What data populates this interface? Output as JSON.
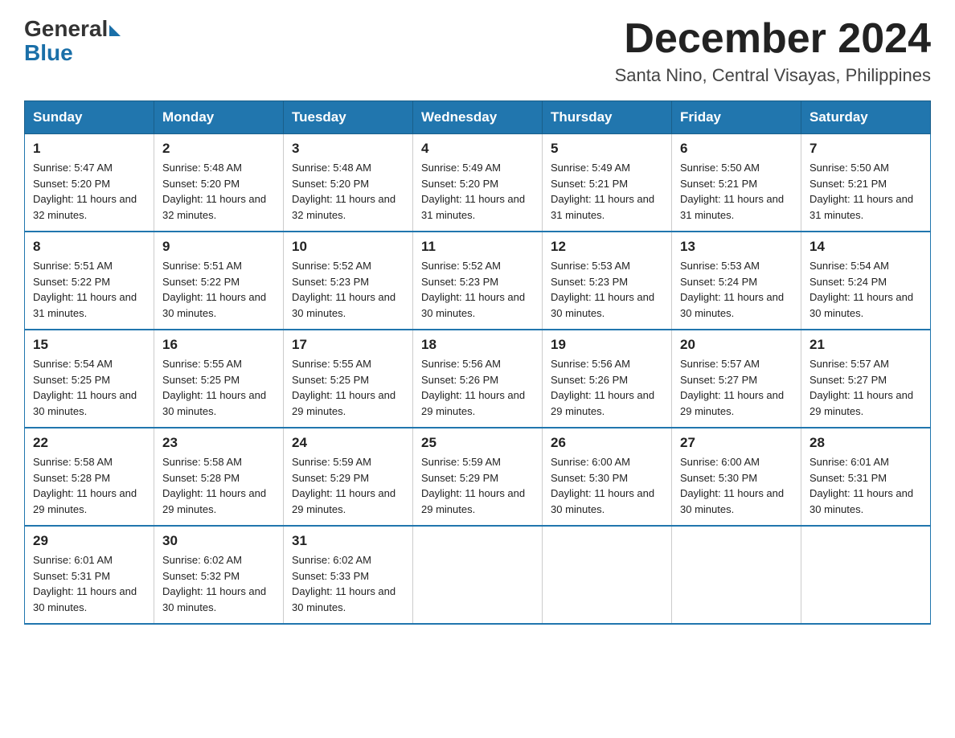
{
  "header": {
    "logo_general": "General",
    "logo_blue": "Blue",
    "month_title": "December 2024",
    "location": "Santa Nino, Central Visayas, Philippines"
  },
  "weekdays": [
    "Sunday",
    "Monday",
    "Tuesday",
    "Wednesday",
    "Thursday",
    "Friday",
    "Saturday"
  ],
  "weeks": [
    [
      {
        "day": "1",
        "sunrise": "5:47 AM",
        "sunset": "5:20 PM",
        "daylight": "11 hours and 32 minutes."
      },
      {
        "day": "2",
        "sunrise": "5:48 AM",
        "sunset": "5:20 PM",
        "daylight": "11 hours and 32 minutes."
      },
      {
        "day": "3",
        "sunrise": "5:48 AM",
        "sunset": "5:20 PM",
        "daylight": "11 hours and 32 minutes."
      },
      {
        "day": "4",
        "sunrise": "5:49 AM",
        "sunset": "5:20 PM",
        "daylight": "11 hours and 31 minutes."
      },
      {
        "day": "5",
        "sunrise": "5:49 AM",
        "sunset": "5:21 PM",
        "daylight": "11 hours and 31 minutes."
      },
      {
        "day": "6",
        "sunrise": "5:50 AM",
        "sunset": "5:21 PM",
        "daylight": "11 hours and 31 minutes."
      },
      {
        "day": "7",
        "sunrise": "5:50 AM",
        "sunset": "5:21 PM",
        "daylight": "11 hours and 31 minutes."
      }
    ],
    [
      {
        "day": "8",
        "sunrise": "5:51 AM",
        "sunset": "5:22 PM",
        "daylight": "11 hours and 31 minutes."
      },
      {
        "day": "9",
        "sunrise": "5:51 AM",
        "sunset": "5:22 PM",
        "daylight": "11 hours and 30 minutes."
      },
      {
        "day": "10",
        "sunrise": "5:52 AM",
        "sunset": "5:23 PM",
        "daylight": "11 hours and 30 minutes."
      },
      {
        "day": "11",
        "sunrise": "5:52 AM",
        "sunset": "5:23 PM",
        "daylight": "11 hours and 30 minutes."
      },
      {
        "day": "12",
        "sunrise": "5:53 AM",
        "sunset": "5:23 PM",
        "daylight": "11 hours and 30 minutes."
      },
      {
        "day": "13",
        "sunrise": "5:53 AM",
        "sunset": "5:24 PM",
        "daylight": "11 hours and 30 minutes."
      },
      {
        "day": "14",
        "sunrise": "5:54 AM",
        "sunset": "5:24 PM",
        "daylight": "11 hours and 30 minutes."
      }
    ],
    [
      {
        "day": "15",
        "sunrise": "5:54 AM",
        "sunset": "5:25 PM",
        "daylight": "11 hours and 30 minutes."
      },
      {
        "day": "16",
        "sunrise": "5:55 AM",
        "sunset": "5:25 PM",
        "daylight": "11 hours and 30 minutes."
      },
      {
        "day": "17",
        "sunrise": "5:55 AM",
        "sunset": "5:25 PM",
        "daylight": "11 hours and 29 minutes."
      },
      {
        "day": "18",
        "sunrise": "5:56 AM",
        "sunset": "5:26 PM",
        "daylight": "11 hours and 29 minutes."
      },
      {
        "day": "19",
        "sunrise": "5:56 AM",
        "sunset": "5:26 PM",
        "daylight": "11 hours and 29 minutes."
      },
      {
        "day": "20",
        "sunrise": "5:57 AM",
        "sunset": "5:27 PM",
        "daylight": "11 hours and 29 minutes."
      },
      {
        "day": "21",
        "sunrise": "5:57 AM",
        "sunset": "5:27 PM",
        "daylight": "11 hours and 29 minutes."
      }
    ],
    [
      {
        "day": "22",
        "sunrise": "5:58 AM",
        "sunset": "5:28 PM",
        "daylight": "11 hours and 29 minutes."
      },
      {
        "day": "23",
        "sunrise": "5:58 AM",
        "sunset": "5:28 PM",
        "daylight": "11 hours and 29 minutes."
      },
      {
        "day": "24",
        "sunrise": "5:59 AM",
        "sunset": "5:29 PM",
        "daylight": "11 hours and 29 minutes."
      },
      {
        "day": "25",
        "sunrise": "5:59 AM",
        "sunset": "5:29 PM",
        "daylight": "11 hours and 29 minutes."
      },
      {
        "day": "26",
        "sunrise": "6:00 AM",
        "sunset": "5:30 PM",
        "daylight": "11 hours and 30 minutes."
      },
      {
        "day": "27",
        "sunrise": "6:00 AM",
        "sunset": "5:30 PM",
        "daylight": "11 hours and 30 minutes."
      },
      {
        "day": "28",
        "sunrise": "6:01 AM",
        "sunset": "5:31 PM",
        "daylight": "11 hours and 30 minutes."
      }
    ],
    [
      {
        "day": "29",
        "sunrise": "6:01 AM",
        "sunset": "5:31 PM",
        "daylight": "11 hours and 30 minutes."
      },
      {
        "day": "30",
        "sunrise": "6:02 AM",
        "sunset": "5:32 PM",
        "daylight": "11 hours and 30 minutes."
      },
      {
        "day": "31",
        "sunrise": "6:02 AM",
        "sunset": "5:33 PM",
        "daylight": "11 hours and 30 minutes."
      },
      null,
      null,
      null,
      null
    ]
  ]
}
